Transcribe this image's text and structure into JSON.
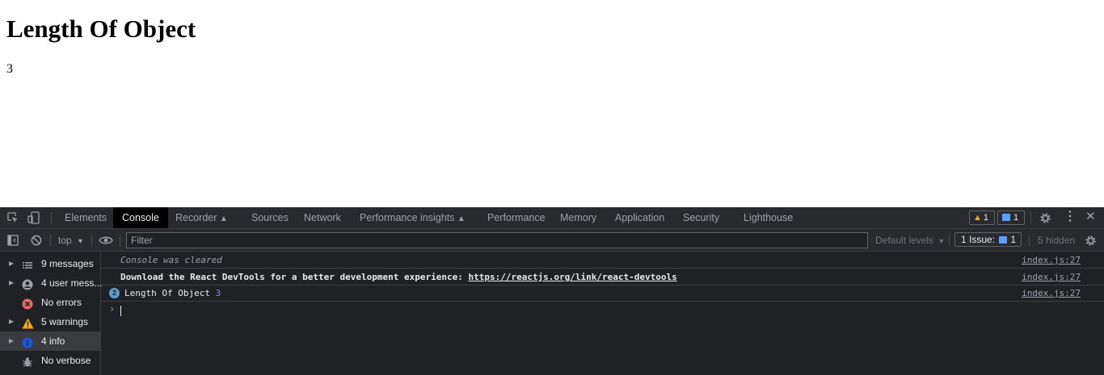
{
  "page": {
    "heading": "Length Of Object",
    "value": "3"
  },
  "devtools": {
    "tabs": [
      "Elements",
      "Console",
      "Recorder",
      "Sources",
      "Network",
      "Performance insights",
      "Performance",
      "Memory",
      "Application",
      "Security",
      "Lighthouse"
    ],
    "active_tab": "Console",
    "warnings_badge": "1",
    "messages_badge": "1",
    "toolbar": {
      "context": "top",
      "filter_placeholder": "Filter",
      "levels": "Default levels",
      "issues": "1 Issue:",
      "issues_count": "1",
      "hidden": "5 hidden"
    },
    "sidebar": [
      {
        "label": "9 messages",
        "icon": "list-icon",
        "expandable": true
      },
      {
        "label": "4 user mess...",
        "icon": "user-icon",
        "expandable": true
      },
      {
        "label": "No errors",
        "icon": "error-icon",
        "expandable": false
      },
      {
        "label": "5 warnings",
        "icon": "warning-icon",
        "expandable": true
      },
      {
        "label": "4 info",
        "icon": "info-icon",
        "expandable": true,
        "selected": true
      },
      {
        "label": "No verbose",
        "icon": "bug-icon",
        "expandable": false
      }
    ],
    "console": {
      "cleared": "Console was cleared",
      "download_text": "Download the React DevTools for a better development experience: ",
      "download_link": "https://reactjs.org/link/react-devtools",
      "log_count": "2",
      "log_text": "Length Of Object",
      "log_value": "3",
      "source": "index.js:27"
    }
  }
}
